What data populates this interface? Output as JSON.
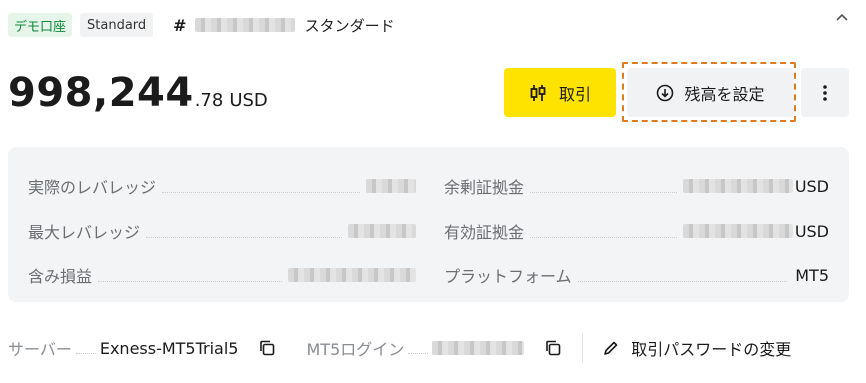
{
  "header": {
    "demo_badge": "デモ口座",
    "type_badge": "Standard",
    "hash": "#",
    "account_type_name": "スタンダード"
  },
  "balance": {
    "integer": "998,244",
    "decimal": ".78",
    "currency": "USD"
  },
  "actions": {
    "trade_label": "取引",
    "set_balance_label": "残高を設定"
  },
  "details": {
    "actual_leverage_label": "実際のレバレッジ",
    "max_leverage_label": "最大レバレッジ",
    "unrealized_pl_label": "含み損益",
    "free_margin_label": "余剰証拠金",
    "free_margin_suffix": "USD",
    "equity_label": "有効証拠金",
    "equity_suffix": "USD",
    "platform_label": "プラットフォーム",
    "platform_value": "MT5"
  },
  "footer": {
    "server_label": "サーバー",
    "server_value": "Exness-MT5Trial5",
    "login_label": "MT5ログイン",
    "change_password_label": "取引パスワードの変更"
  },
  "colors": {
    "accent_yellow": "#ffe300",
    "focus_orange": "#e07a1f",
    "demo_green": "#0e8a3a"
  }
}
